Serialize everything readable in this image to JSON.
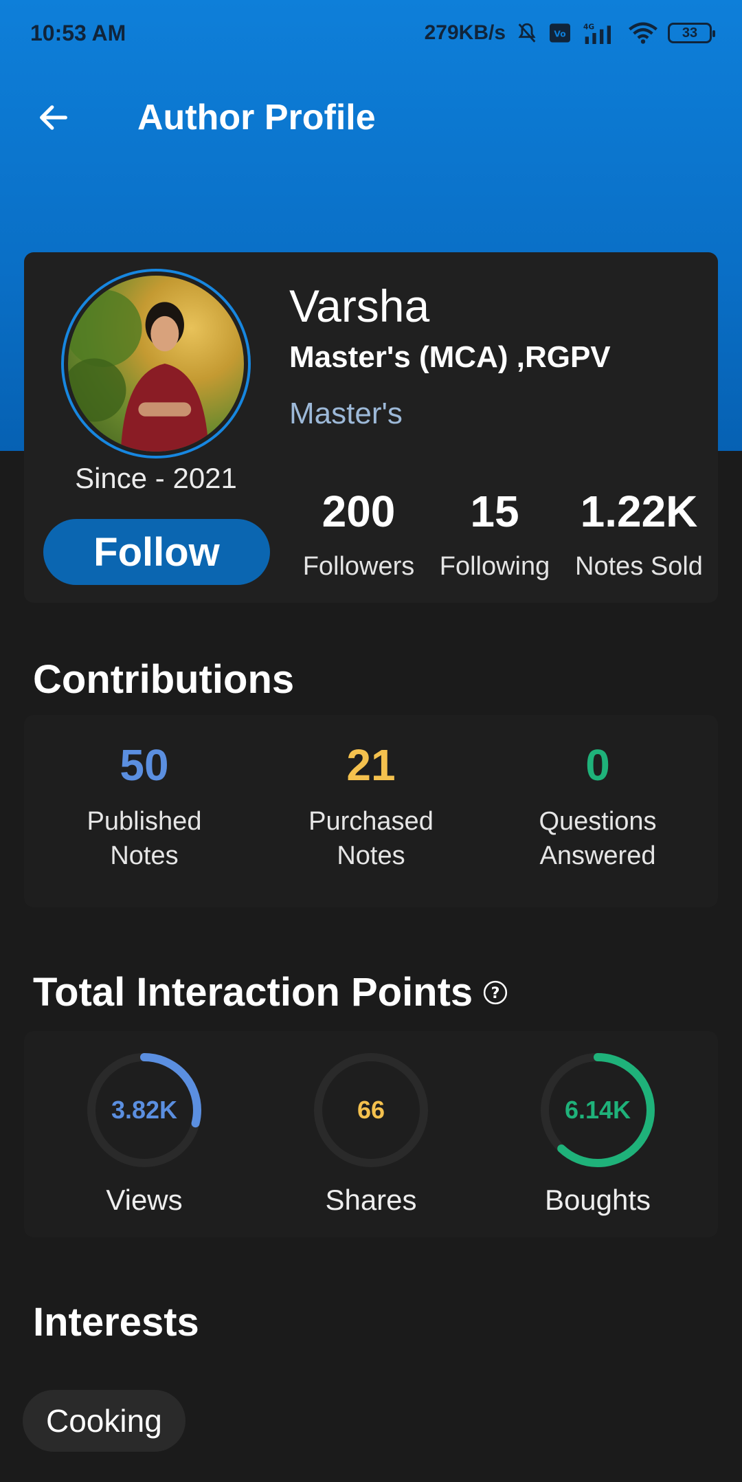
{
  "status_bar": {
    "time": "10:53 AM",
    "net_speed": "279KB/s",
    "battery": "33",
    "icons": [
      "mute-bell-icon",
      "volte-icon",
      "signal-4g-icon",
      "wifi-icon",
      "battery-icon"
    ]
  },
  "app_bar": {
    "title": "Author Profile",
    "back_icon": "arrow-left-icon"
  },
  "profile": {
    "name": "Varsha",
    "degree": "Master's (MCA) ,RGPV",
    "level": "Master's",
    "since": "Since - 2021",
    "follow_label": "Follow",
    "stats": [
      {
        "value": "200",
        "label": "Followers"
      },
      {
        "value": "15",
        "label": "Following"
      },
      {
        "value": "1.22K",
        "label": "Notes Sold"
      }
    ]
  },
  "contributions": {
    "title": "Contributions",
    "items": [
      {
        "value": "50",
        "label_line1": "Published",
        "label_line2": "Notes",
        "color": "#5b8fe0"
      },
      {
        "value": "21",
        "label_line1": "Purchased",
        "label_line2": "Notes",
        "color": "#f4c14e"
      },
      {
        "value": "0",
        "label_line1": "Questions",
        "label_line2": "Answered",
        "color": "#1fb27a"
      }
    ]
  },
  "interaction": {
    "title": "Total Interaction Points",
    "help_icon": "question-circle-icon",
    "items": [
      {
        "value": "3.82K",
        "label": "Views",
        "color": "#5b8fe0",
        "progress": 0.29
      },
      {
        "value": "66",
        "label": "Shares",
        "color": "#f4c14e",
        "progress": 0.0
      },
      {
        "value": "6.14K",
        "label": "Boughts",
        "color": "#1fb27a",
        "progress": 0.62
      }
    ]
  },
  "interests": {
    "title": "Interests",
    "chips": [
      "Cooking"
    ]
  }
}
